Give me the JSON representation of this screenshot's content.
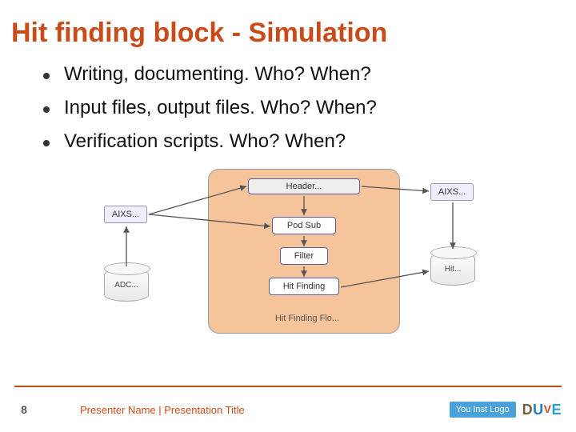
{
  "title": "Hit finding block - Simulation",
  "bullets": [
    "Writing, documenting. Who? When?",
    "Input files, output files. Who? When?",
    "Verification scripts. Who? When?"
  ],
  "diagram": {
    "header": "Header...",
    "pod": "Pod Sub",
    "filter": "Filter",
    "hit_finding": "Hit Finding",
    "caption": "Hit Finding Flo...",
    "ext_left": "AIXS...",
    "ext_right": "AIXS...",
    "cyl_left": "ADC...",
    "cyl_right": "Hit..."
  },
  "footer": {
    "page": "8",
    "text": "Presenter Name | Presentation Title",
    "inst_logo": "You Inst Logo",
    "brand_d": "D",
    "brand_u": "U",
    "brand_v": "V",
    "brand_e": "E"
  }
}
